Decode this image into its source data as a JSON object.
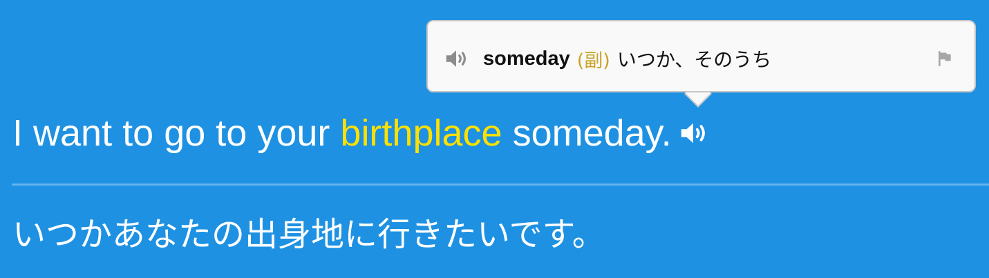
{
  "sentence": {
    "words": [
      "I",
      "want",
      "to",
      "go",
      "to",
      "your",
      "birthplace",
      "someday."
    ],
    "highlighted_word": "birthplace",
    "audio_icon": "speaker-icon"
  },
  "translation": {
    "text": "いつかあなたの出身地に行きたいです。"
  },
  "popup": {
    "word": "someday",
    "part_of_speech": "(副)",
    "meaning": "いつか、そのうち",
    "audio_icon": "speaker-icon",
    "flag_icon": "flag-icon"
  },
  "colors": {
    "background": "#1e91e3",
    "highlight": "#ffe100",
    "part_of_speech": "#c9a227",
    "popup_background": "#f9f9f9"
  }
}
